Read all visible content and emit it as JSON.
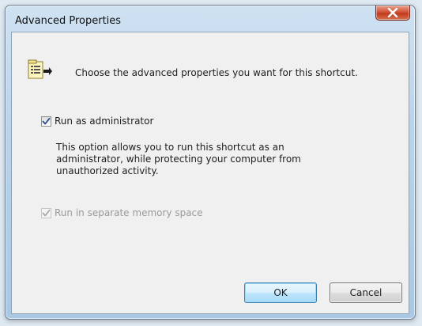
{
  "window": {
    "title": "Advanced Properties"
  },
  "header": {
    "text": "Choose the advanced properties you want for this shortcut.",
    "icon": "properties-icon"
  },
  "options": {
    "run_as_admin": {
      "label": "Run as administrator",
      "checked": true,
      "enabled": true
    },
    "description": "This option allows you to run this shortcut as an administrator, while protecting your computer from unauthorized activity.",
    "separate_memory": {
      "label": "Run in separate memory space",
      "checked": true,
      "enabled": false
    }
  },
  "buttons": {
    "ok_label": "OK",
    "cancel_label": "Cancel"
  },
  "colors": {
    "accent": "#3c7fb1",
    "close_button": "#c03a1d",
    "dialog_background": "#f0f0f0",
    "disabled_text": "#9a9a9a"
  }
}
